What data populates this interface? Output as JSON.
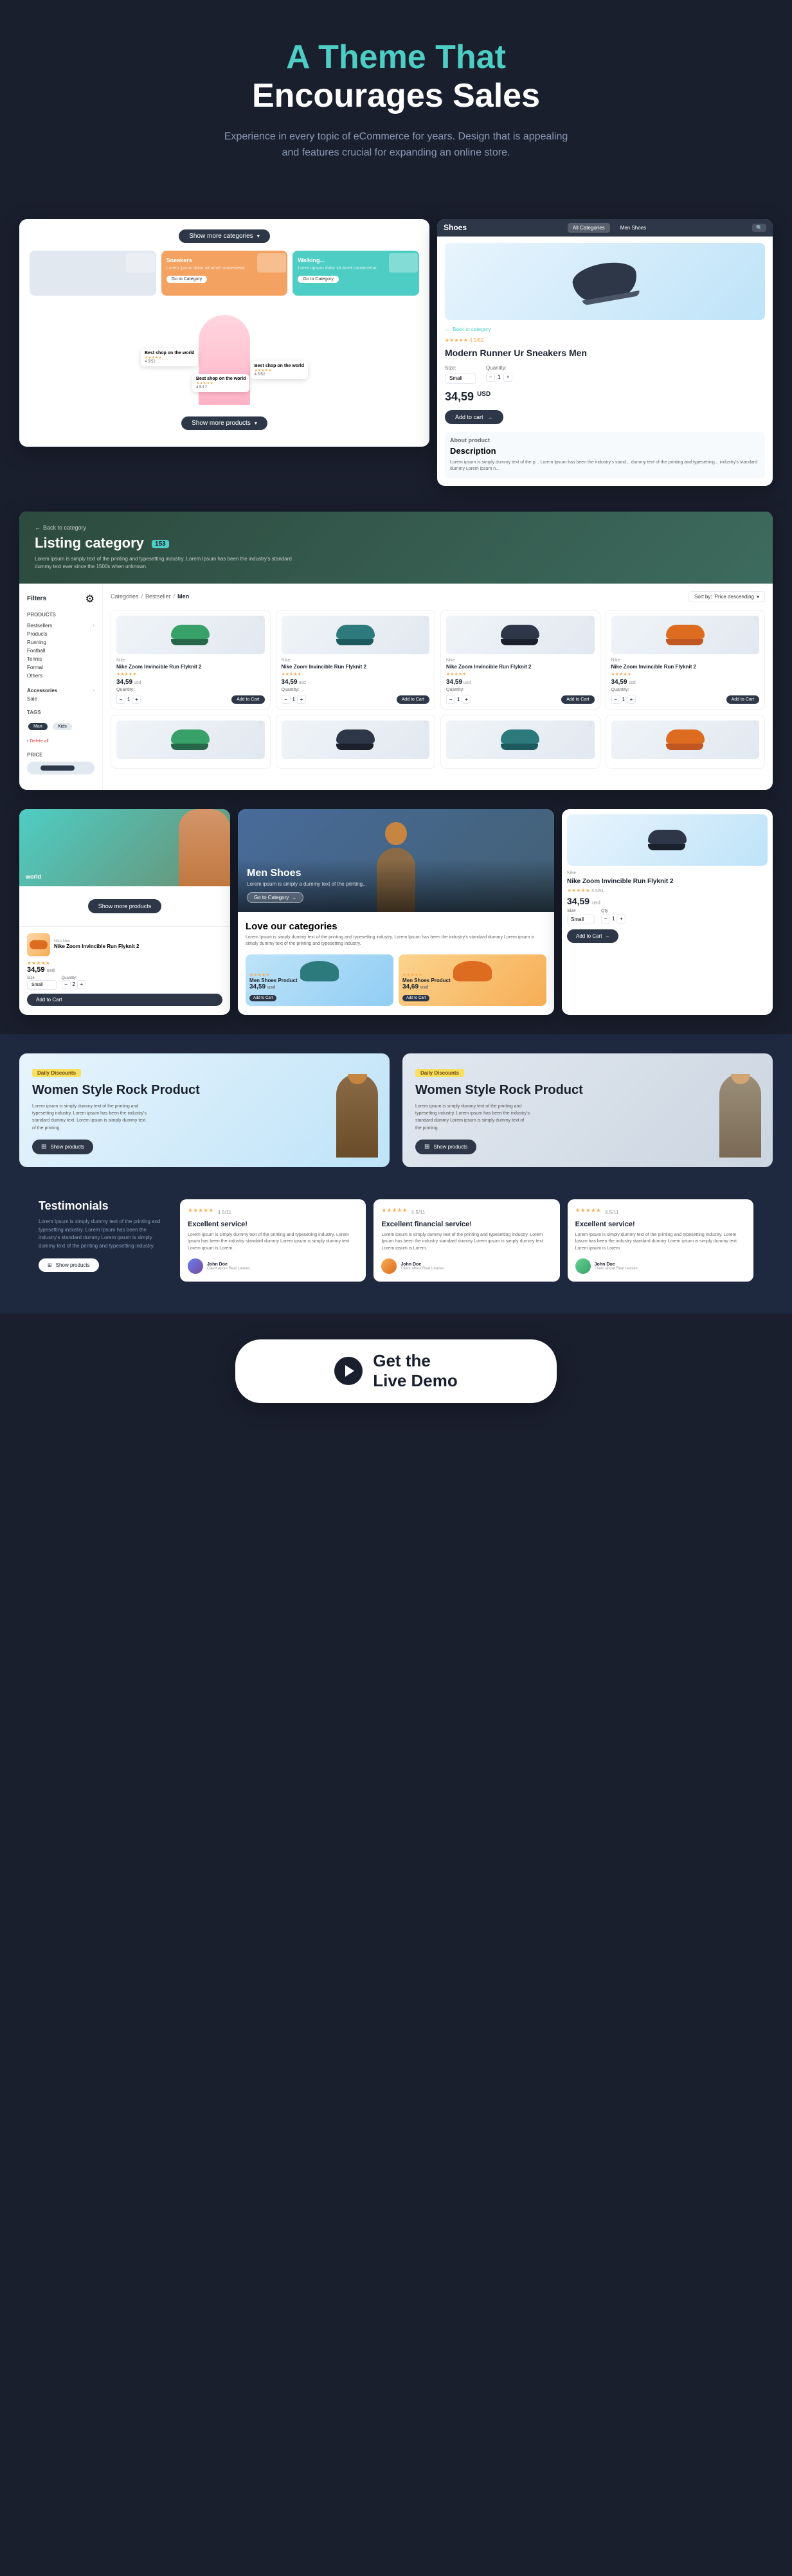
{
  "hero": {
    "title_line1": "A Theme That",
    "title_line2": "Encourages Sales",
    "title_accent": "A Theme That",
    "subtitle": "Experience in every topic of eCommerce for years. Design that is appealing and features crucial for expanding an online store."
  },
  "leftCard": {
    "show_more_categories_btn": "Show more categories",
    "categories": [
      {
        "name": "Sneakers",
        "sub": "Lorem ipsum dolor sit amet consectetur",
        "btn": "Go to Category"
      },
      {
        "name": "Walking...",
        "sub": "Lorem ipsum dolor sit amet consectetur",
        "btn": "Go to Category"
      }
    ],
    "badges": [
      {
        "text": "Best shop on the world",
        "stars": "★★★★★",
        "rating": "4.5/52"
      },
      {
        "text": "Best shop on the world",
        "stars": "★★★★★",
        "rating": "4.5/17"
      },
      {
        "text": "Best shop on the world",
        "stars": "★★★★★",
        "rating": "4.5/52"
      }
    ],
    "show_more_products_btn": "Show more products"
  },
  "rightCard": {
    "title": "Shoes",
    "tabs": [
      "All Categories",
      "Men Shoes"
    ],
    "back_link": "Back to category",
    "rating": "★★★★★ 4.5/52",
    "product_title": "Modern Runner Ur Sneakers Men",
    "size_label": "Size:",
    "size_option": "Small",
    "qty_label": "Quantity:",
    "qty_value": "1",
    "price": "34,59",
    "currency": "USD",
    "add_to_cart": "Add to cart",
    "about_label": "About product",
    "desc_title": "Description",
    "desc_text": "Lorem ipsum is simply dummy text of the p... Lorem Ipsum has been the industry's stand... dummy text of the printing and typesetting... industry's standard dummy Lorem ipsum n..."
  },
  "listingSection": {
    "back_link": "Back to category",
    "title": "Listing category",
    "count": "153",
    "subtitle": "Lorem ipsum is simply text of the printing and typesetting industry. Lorem Ipsum has been the industry's standard dummy text ever since the 1500s when unknown.",
    "filter_label": "Filters",
    "categories_label": "Categories",
    "breadcrumb": [
      "Categories",
      "Bestseller",
      "Men"
    ],
    "sort_label": "Sort by:",
    "sort_option": "Price descending",
    "products_section": "PRODUCTS",
    "filter_items": [
      "Bestsellers",
      "Products",
      "Running",
      "Football",
      "Tennis",
      "Formal",
      "Others"
    ],
    "accessories_label": "Accessories",
    "accessories_items": [
      "Sale"
    ],
    "tags_label": "TAGS",
    "tag_items": [
      "Man",
      "Kids",
      "Delete all"
    ],
    "price_label": "PRICE",
    "products": [
      {
        "brand": "Nike",
        "name": "Nike Zoom Invincible Run Flyknit 2",
        "stars": "★★★★★",
        "rating": "4.5/11",
        "price": "34,59",
        "currency": "usd",
        "qty": "1"
      },
      {
        "brand": "Nike",
        "name": "Nike Zoom Invincible Run Flyknit 2",
        "stars": "★★★★★",
        "rating": "4.5/11",
        "price": "34,59",
        "currency": "usd",
        "qty": "1"
      },
      {
        "brand": "Nike",
        "name": "Nike Zoom Invincible Run Flyknit 2",
        "stars": "★★★★★",
        "rating": "4.5/11",
        "price": "34,59",
        "currency": "usd",
        "qty": "1"
      },
      {
        "brand": "Nike",
        "name": "Nike Zoom Invincible Run Flyknit 2",
        "stars": "★★★★★",
        "rating": "4.5/11",
        "price": "34,59",
        "currency": "usd",
        "qty": "1"
      }
    ]
  },
  "threeCol": {
    "left": {
      "show_more_btn": "Show more products",
      "product": {
        "brand": "Nike Men",
        "name": "Nike Zoom Invincible Run Flyknit 2",
        "stars": "★★★★★",
        "rating": "4.5/11",
        "price": "34,59",
        "currency": "usd",
        "size_label": "Size",
        "size": "Small",
        "qty": "2",
        "add_btn": "Add to Cart"
      }
    },
    "center": {
      "hero_title": "Men Shoes",
      "hero_sub": "Lorem ipsum is simply a dummy text of the printing...",
      "hero_btn": "Go to Category",
      "love_title": "Love our categories",
      "love_sub": "Lorem Ipsum is simply dummy text of the printing and typesetting industry. Lorem Ipsum has been the industry's standard dummy Lorem ipsum is simply dummy text of the printing and typesetting industry.",
      "love_items": [
        {
          "name": "Men Shoes Product",
          "stars": "★★★★★",
          "rating": "4.5",
          "price": "34,59",
          "btn": "Add to Cart"
        },
        {
          "name": "Men Shoes Product",
          "stars": "★★★★★",
          "rating": "4.5",
          "price": "34,69",
          "btn": "Add to Cart"
        }
      ]
    },
    "right": {
      "brand": "Nike",
      "name": "Nike Zoom Invincible Run Flyknit 2",
      "stars": "★★★★★",
      "rating": "4.5/51",
      "price": "34,59",
      "currency": "usd",
      "size_label": "Size",
      "size": "Small",
      "qty_label": "Qty",
      "add_btn": "Add to Cart"
    }
  },
  "promoSection": {
    "cards": [
      {
        "badge": "Daily Discounts",
        "title": "Women Style Rock Product",
        "sub": "Lorem ipsum is simply dummy text of the printing and typesetting industry. Lorem ipsum has been the industry's standard dummy text. Lorem ipsum is simply dummy text of the printing.",
        "btn": "Show products"
      },
      {
        "badge": "Daily Discounts",
        "title": "Women Style Rock Product",
        "sub": "Lorem ipsum is simply dummy text of the printing and typesetting industry. Lorem ipsum has been the industry's standard dummy Lorem ipsum is simply dummy text of the printing.",
        "btn": "Show products"
      }
    ]
  },
  "testimonials": {
    "title": "Testimonials",
    "sub": "Lorem Ipsum is simply dummy text of the printing and typesetting industry. Lorem Ipsum has been the industry's standard dummy Lorem ipsum is simply dummy text of the printing and typesetting industry.",
    "show_btn": "Show products",
    "cards": [
      {
        "stars": "★★★★★",
        "rating": "4.5/11",
        "heading": "Excellent service!",
        "text": "Lorem ipsum is simply dummy text of the printing and typesetting industry. Lorem Ipsum has been the industry standard dummy Lorem ipsum is simply dummy text Lorem ipsum is Lorem.",
        "author": "John Doe",
        "role": "Client about Real Leaves"
      },
      {
        "stars": "★★★★★",
        "rating": "4.5/11",
        "heading": "Excellent financial service!",
        "text": "Lorem ipsum is simply dummy text of the printing and typesetting industry. Lorem Ipsum has been the industry standard dummy Lorem ipsum is simply dummy text Lorem ipsum is Lorem.",
        "author": "John Doe",
        "role": "Client about Real Leaves"
      },
      {
        "stars": "★★★★★",
        "rating": "4.5/11",
        "heading": "Excellent service!",
        "text": "Lorem ipsum is simply dummy text of the printing and typesetting industry. Lorem Ipsum has been the industry standard dummy Lorem ipsum is simply dummy text Lorem ipsum is Lorem.",
        "author": "John Doe",
        "role": "Client about Real Leaves"
      }
    ]
  },
  "cta": {
    "label": "Get the\nLive Demo",
    "line1": "Get the",
    "line2": "Live Demo"
  }
}
